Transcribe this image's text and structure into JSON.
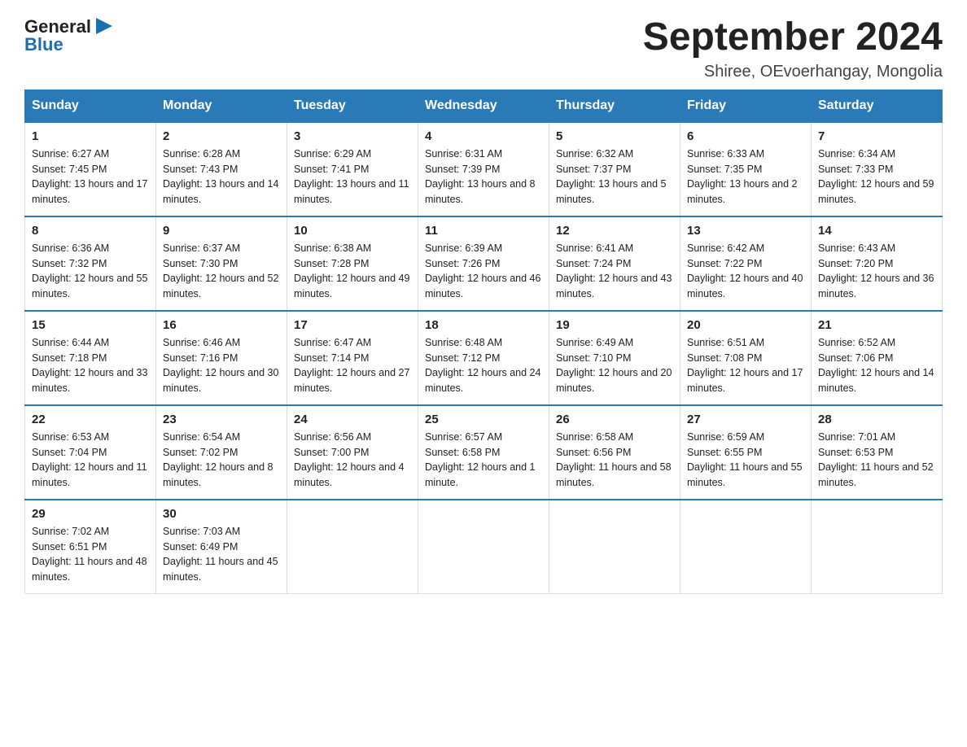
{
  "logo": {
    "general": "General",
    "blue": "Blue",
    "triangle": "▶"
  },
  "title": "September 2024",
  "subtitle": "Shiree, OEvoerhangay, Mongolia",
  "weekdays": [
    "Sunday",
    "Monday",
    "Tuesday",
    "Wednesday",
    "Thursday",
    "Friday",
    "Saturday"
  ],
  "weeks": [
    [
      {
        "day": "1",
        "sunrise": "6:27 AM",
        "sunset": "7:45 PM",
        "daylight": "13 hours and 17 minutes."
      },
      {
        "day": "2",
        "sunrise": "6:28 AM",
        "sunset": "7:43 PM",
        "daylight": "13 hours and 14 minutes."
      },
      {
        "day": "3",
        "sunrise": "6:29 AM",
        "sunset": "7:41 PM",
        "daylight": "13 hours and 11 minutes."
      },
      {
        "day": "4",
        "sunrise": "6:31 AM",
        "sunset": "7:39 PM",
        "daylight": "13 hours and 8 minutes."
      },
      {
        "day": "5",
        "sunrise": "6:32 AM",
        "sunset": "7:37 PM",
        "daylight": "13 hours and 5 minutes."
      },
      {
        "day": "6",
        "sunrise": "6:33 AM",
        "sunset": "7:35 PM",
        "daylight": "13 hours and 2 minutes."
      },
      {
        "day": "7",
        "sunrise": "6:34 AM",
        "sunset": "7:33 PM",
        "daylight": "12 hours and 59 minutes."
      }
    ],
    [
      {
        "day": "8",
        "sunrise": "6:36 AM",
        "sunset": "7:32 PM",
        "daylight": "12 hours and 55 minutes."
      },
      {
        "day": "9",
        "sunrise": "6:37 AM",
        "sunset": "7:30 PM",
        "daylight": "12 hours and 52 minutes."
      },
      {
        "day": "10",
        "sunrise": "6:38 AM",
        "sunset": "7:28 PM",
        "daylight": "12 hours and 49 minutes."
      },
      {
        "day": "11",
        "sunrise": "6:39 AM",
        "sunset": "7:26 PM",
        "daylight": "12 hours and 46 minutes."
      },
      {
        "day": "12",
        "sunrise": "6:41 AM",
        "sunset": "7:24 PM",
        "daylight": "12 hours and 43 minutes."
      },
      {
        "day": "13",
        "sunrise": "6:42 AM",
        "sunset": "7:22 PM",
        "daylight": "12 hours and 40 minutes."
      },
      {
        "day": "14",
        "sunrise": "6:43 AM",
        "sunset": "7:20 PM",
        "daylight": "12 hours and 36 minutes."
      }
    ],
    [
      {
        "day": "15",
        "sunrise": "6:44 AM",
        "sunset": "7:18 PM",
        "daylight": "12 hours and 33 minutes."
      },
      {
        "day": "16",
        "sunrise": "6:46 AM",
        "sunset": "7:16 PM",
        "daylight": "12 hours and 30 minutes."
      },
      {
        "day": "17",
        "sunrise": "6:47 AM",
        "sunset": "7:14 PM",
        "daylight": "12 hours and 27 minutes."
      },
      {
        "day": "18",
        "sunrise": "6:48 AM",
        "sunset": "7:12 PM",
        "daylight": "12 hours and 24 minutes."
      },
      {
        "day": "19",
        "sunrise": "6:49 AM",
        "sunset": "7:10 PM",
        "daylight": "12 hours and 20 minutes."
      },
      {
        "day": "20",
        "sunrise": "6:51 AM",
        "sunset": "7:08 PM",
        "daylight": "12 hours and 17 minutes."
      },
      {
        "day": "21",
        "sunrise": "6:52 AM",
        "sunset": "7:06 PM",
        "daylight": "12 hours and 14 minutes."
      }
    ],
    [
      {
        "day": "22",
        "sunrise": "6:53 AM",
        "sunset": "7:04 PM",
        "daylight": "12 hours and 11 minutes."
      },
      {
        "day": "23",
        "sunrise": "6:54 AM",
        "sunset": "7:02 PM",
        "daylight": "12 hours and 8 minutes."
      },
      {
        "day": "24",
        "sunrise": "6:56 AM",
        "sunset": "7:00 PM",
        "daylight": "12 hours and 4 minutes."
      },
      {
        "day": "25",
        "sunrise": "6:57 AM",
        "sunset": "6:58 PM",
        "daylight": "12 hours and 1 minute."
      },
      {
        "day": "26",
        "sunrise": "6:58 AM",
        "sunset": "6:56 PM",
        "daylight": "11 hours and 58 minutes."
      },
      {
        "day": "27",
        "sunrise": "6:59 AM",
        "sunset": "6:55 PM",
        "daylight": "11 hours and 55 minutes."
      },
      {
        "day": "28",
        "sunrise": "7:01 AM",
        "sunset": "6:53 PM",
        "daylight": "11 hours and 52 minutes."
      }
    ],
    [
      {
        "day": "29",
        "sunrise": "7:02 AM",
        "sunset": "6:51 PM",
        "daylight": "11 hours and 48 minutes."
      },
      {
        "day": "30",
        "sunrise": "7:03 AM",
        "sunset": "6:49 PM",
        "daylight": "11 hours and 45 minutes."
      },
      null,
      null,
      null,
      null,
      null
    ]
  ]
}
